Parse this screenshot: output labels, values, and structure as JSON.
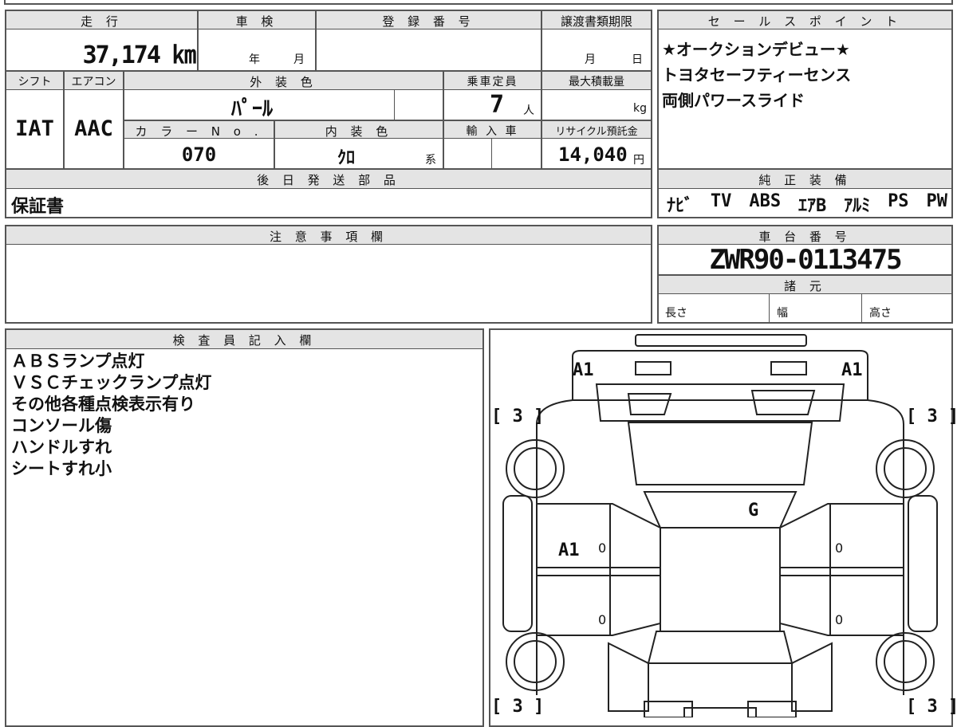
{
  "labels": {
    "mileage": "走 行",
    "inspection": "車 検",
    "registration": "登 録 番 号",
    "transfer_deadline": "譲渡書類期限",
    "sales_points": "セ ー ル ス ポ イ ン ト",
    "shift": "シフト",
    "aircon": "エアコン",
    "exterior_color": "外 装 色",
    "capacity": "乗車定員",
    "max_load": "最大積載量",
    "color_no": "カ ラ ー N o .",
    "interior_color": "内 装 色",
    "import": "輸 入 車",
    "recycle": "リサイクル預託金",
    "later_parts": "後 日 発 送 部 品",
    "genuine_equipment": "純 正 装 備",
    "notes": "注 意 事 項 欄",
    "chassis": "車 台 番 号",
    "specs": "諸 元",
    "length": "長さ",
    "width": "幅",
    "height": "高さ",
    "inspector": "検 査 員 記 入 欄"
  },
  "values": {
    "mileage": "37,174 ㎞",
    "inspection_year_unit": "年",
    "inspection_month_unit": "月",
    "transfer_month_unit": "月",
    "transfer_day_unit": "日",
    "shift": "IAT",
    "aircon": "AAC",
    "exterior_color": "ﾊﾟｰﾙ",
    "capacity": "7",
    "capacity_unit": "人",
    "load_unit": "kg",
    "color_no": "070",
    "interior_color": "ｸﾛ",
    "interior_suffix": "系",
    "recycle": "14,040",
    "recycle_unit": "円",
    "later_parts": "保証書",
    "chassis": "ZWR90-0113475"
  },
  "sales_points": [
    "★オークションデビュー★",
    "トヨタセーフティーセンス",
    "両側パワースライド"
  ],
  "equipment": [
    "ﾅﾋﾞ",
    "TV",
    "ABS",
    "ｴｱB",
    "ｱﾙﾐ",
    "PS",
    "PW"
  ],
  "inspector_notes": [
    "ＡＢＳランプ点灯",
    "ＶＳＣチェックランプ点灯",
    "その他各種点検表示有り",
    "コンソール傷",
    "ハンドルすれ",
    "シートすれ小"
  ],
  "diagram": {
    "marks": {
      "front_left": "A1",
      "front_right": "A1",
      "center": "G",
      "left_side": "A1"
    },
    "tire_marks": [
      "[ 3 ]",
      "[ 3 ]",
      "[ 3 ]",
      "[ 3 ]"
    ],
    "zero": "0"
  }
}
